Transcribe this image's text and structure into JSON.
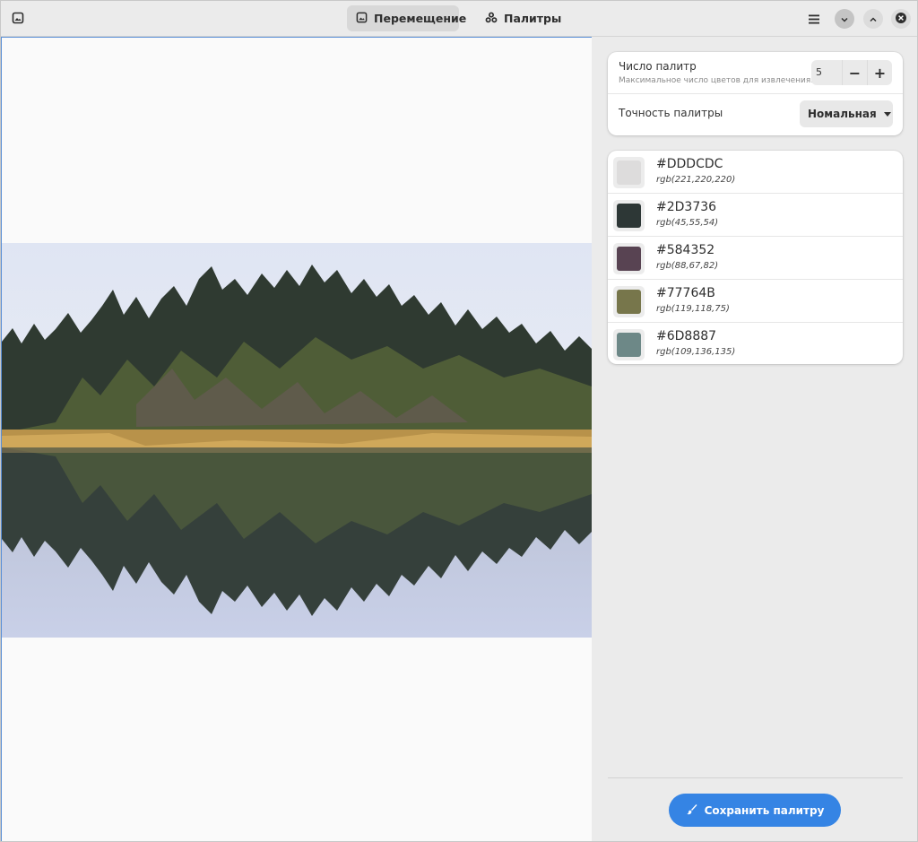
{
  "header": {
    "tabs": [
      {
        "label": "Перемещение",
        "icon": "image-icon",
        "active": true
      },
      {
        "label": "Палитры",
        "icon": "palette-icon",
        "active": false
      }
    ],
    "menu_icon": "hamburger-icon",
    "window_controls": [
      "minimize-icon",
      "maximize-icon",
      "close-icon"
    ]
  },
  "settings": {
    "count_title": "Число палитр",
    "count_subtitle": "Максимальное число цветов для извлечения.",
    "count_value": "5",
    "decrement_label": "−",
    "increment_label": "+",
    "accuracy_label": "Точность палитры",
    "accuracy_value": "Номальная"
  },
  "palette": [
    {
      "hex": "#DDDCDC",
      "rgb": "rgb(221,220,220)",
      "color": "#DDDCDC"
    },
    {
      "hex": "#2D3736",
      "rgb": "rgb(45,55,54)",
      "color": "#2D3736"
    },
    {
      "hex": "#584352",
      "rgb": "rgb(88,67,82)",
      "color": "#584352"
    },
    {
      "hex": "#77764B",
      "rgb": "rgb(119,118,75)",
      "color": "#77764B"
    },
    {
      "hex": "#6D8887",
      "rgb": "rgb(109,136,135)",
      "color": "#6D8887"
    }
  ],
  "save_button": {
    "label": "Сохранить палитру",
    "icon": "brush-icon"
  },
  "colors": {
    "accent": "#3584e4"
  }
}
